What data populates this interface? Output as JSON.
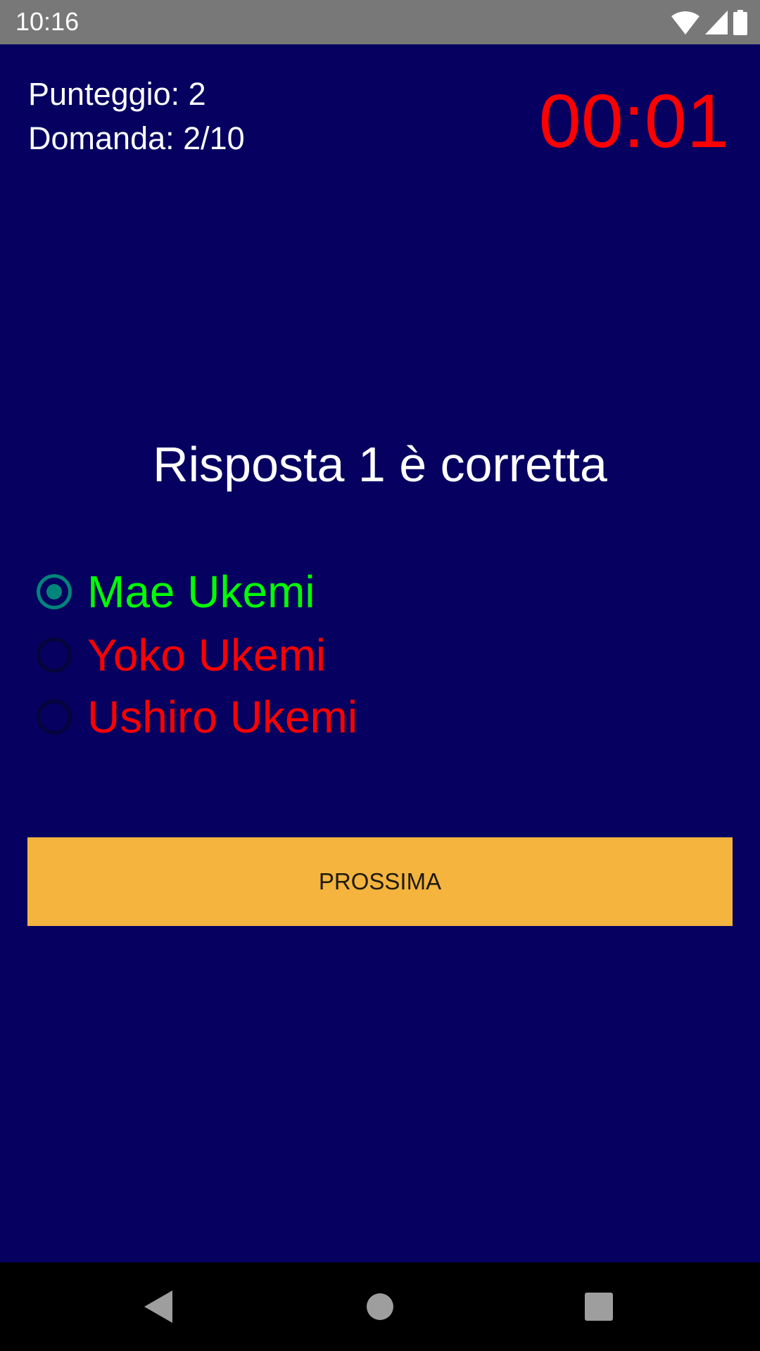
{
  "status_bar": {
    "time": "10:16"
  },
  "header": {
    "score": "Punteggio: 2",
    "question_counter": "Domanda: 2/10",
    "timer": "00:01"
  },
  "question": {
    "text": "Risposta 1 è corretta"
  },
  "options": [
    {
      "label": "Mae Ukemi",
      "selected": true,
      "color": "#00ff00"
    },
    {
      "label": "Yoko Ukemi",
      "selected": false,
      "color": "#ff0000"
    },
    {
      "label": "Ushiro Ukemi",
      "selected": false,
      "color": "#ff0000"
    }
  ],
  "next_button": {
    "label": "PROSSIMA",
    "color": "#f4b43e"
  },
  "colors": {
    "background": "#060060",
    "timer": "#ff0000"
  }
}
